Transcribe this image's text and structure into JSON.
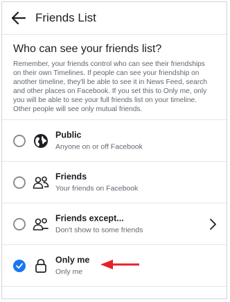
{
  "header": {
    "title": "Friends List"
  },
  "intro": {
    "heading": "Who can see your friends list?",
    "description": "Remember, your friends control who can see their friendships on their own Timelines. If people can see your friendship on another timeline, they'll be able to see it in News Feed, search and other places on Facebook. If you set this to Only me, only you will be able to see your full friends list on your timeline. Other people will see only mutual friends."
  },
  "options": [
    {
      "title": "Public",
      "subtitle": "Anyone on or off Facebook",
      "icon": "globe-icon",
      "selected": false
    },
    {
      "title": "Friends",
      "subtitle": "Your friends on Facebook",
      "icon": "friends-icon",
      "selected": false
    },
    {
      "title": "Friends except...",
      "subtitle": "Don't show to some friends",
      "icon": "friends-except-icon",
      "selected": false,
      "has_chevron": true
    },
    {
      "title": "Only me",
      "subtitle": "Only me",
      "icon": "lock-icon",
      "selected": true
    }
  ],
  "colors": {
    "accent": "#1877f2",
    "annotation_arrow": "#e8202a"
  }
}
